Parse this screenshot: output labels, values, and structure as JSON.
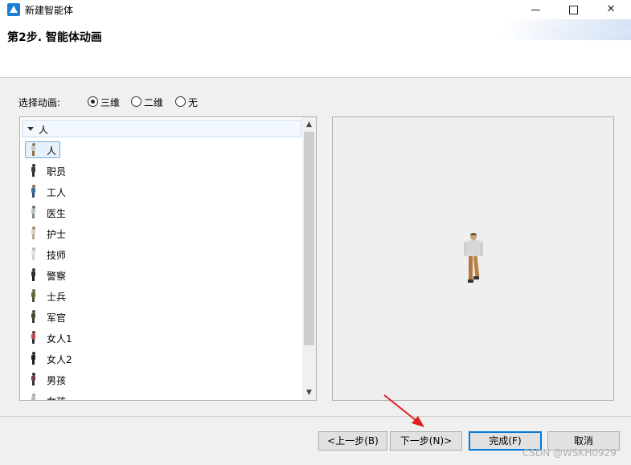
{
  "window": {
    "title": "新建智能体",
    "minimize_icon": "minimize-icon",
    "maximize_icon": "maximize-icon",
    "close_glyph": "✕"
  },
  "header": {
    "step_title": "第2步. 智能体动画"
  },
  "animation": {
    "label": "选择动画:",
    "options": [
      {
        "label": "三维",
        "checked": true
      },
      {
        "label": "二维",
        "checked": false
      },
      {
        "label": "无",
        "checked": false
      }
    ]
  },
  "tree": {
    "group": "人",
    "items": [
      {
        "label": "人",
        "selected": true,
        "colors": [
          "#8a7a66",
          "#c9c9c9",
          "#8a6a3a"
        ]
      },
      {
        "label": "职员",
        "selected": false,
        "colors": [
          "#333333",
          "#3a3a3a",
          "#2b2b2b"
        ]
      },
      {
        "label": "工人",
        "selected": false,
        "colors": [
          "#8a6a4a",
          "#3f6fa0",
          "#2d4d70"
        ]
      },
      {
        "label": "医生",
        "selected": false,
        "colors": [
          "#7a6a5a",
          "#b8c4c8",
          "#7c8a90"
        ]
      },
      {
        "label": "护士",
        "selected": false,
        "colors": [
          "#a88a6a",
          "#d8cfc0",
          "#b8a890"
        ]
      },
      {
        "label": "技师",
        "selected": false,
        "colors": [
          "#c0b8a8",
          "#e0e0e0",
          "#d0d0d0"
        ]
      },
      {
        "label": "警察",
        "selected": false,
        "colors": [
          "#3a3a3a",
          "#2a2f3a",
          "#1a1a1a"
        ]
      },
      {
        "label": "士兵",
        "selected": false,
        "colors": [
          "#6a6a4a",
          "#5a6a3a",
          "#4a5030"
        ]
      },
      {
        "label": "军官",
        "selected": false,
        "colors": [
          "#5a4a3a",
          "#4a4a3a",
          "#3a3a2a"
        ]
      },
      {
        "label": "女人1",
        "selected": false,
        "colors": [
          "#6a3a2a",
          "#c04a5a",
          "#2a2a2a"
        ]
      },
      {
        "label": "女人2",
        "selected": false,
        "colors": [
          "#2a2a2a",
          "#222222",
          "#1a1a1a"
        ]
      },
      {
        "label": "男孩",
        "selected": false,
        "colors": [
          "#3a2a2a",
          "#7a3a4a",
          "#2a2a3a"
        ]
      },
      {
        "label": "女孩",
        "selected": false,
        "colors": [
          "#aaaaaa",
          "#bbbbbb",
          "#999999"
        ]
      }
    ]
  },
  "buttons": {
    "back": "<上一步(B)",
    "next": "下一步(N)>",
    "finish": "完成(F)",
    "cancel": "取消"
  },
  "watermark": "CSDN @WSKH0929",
  "accent": "#0078d7"
}
